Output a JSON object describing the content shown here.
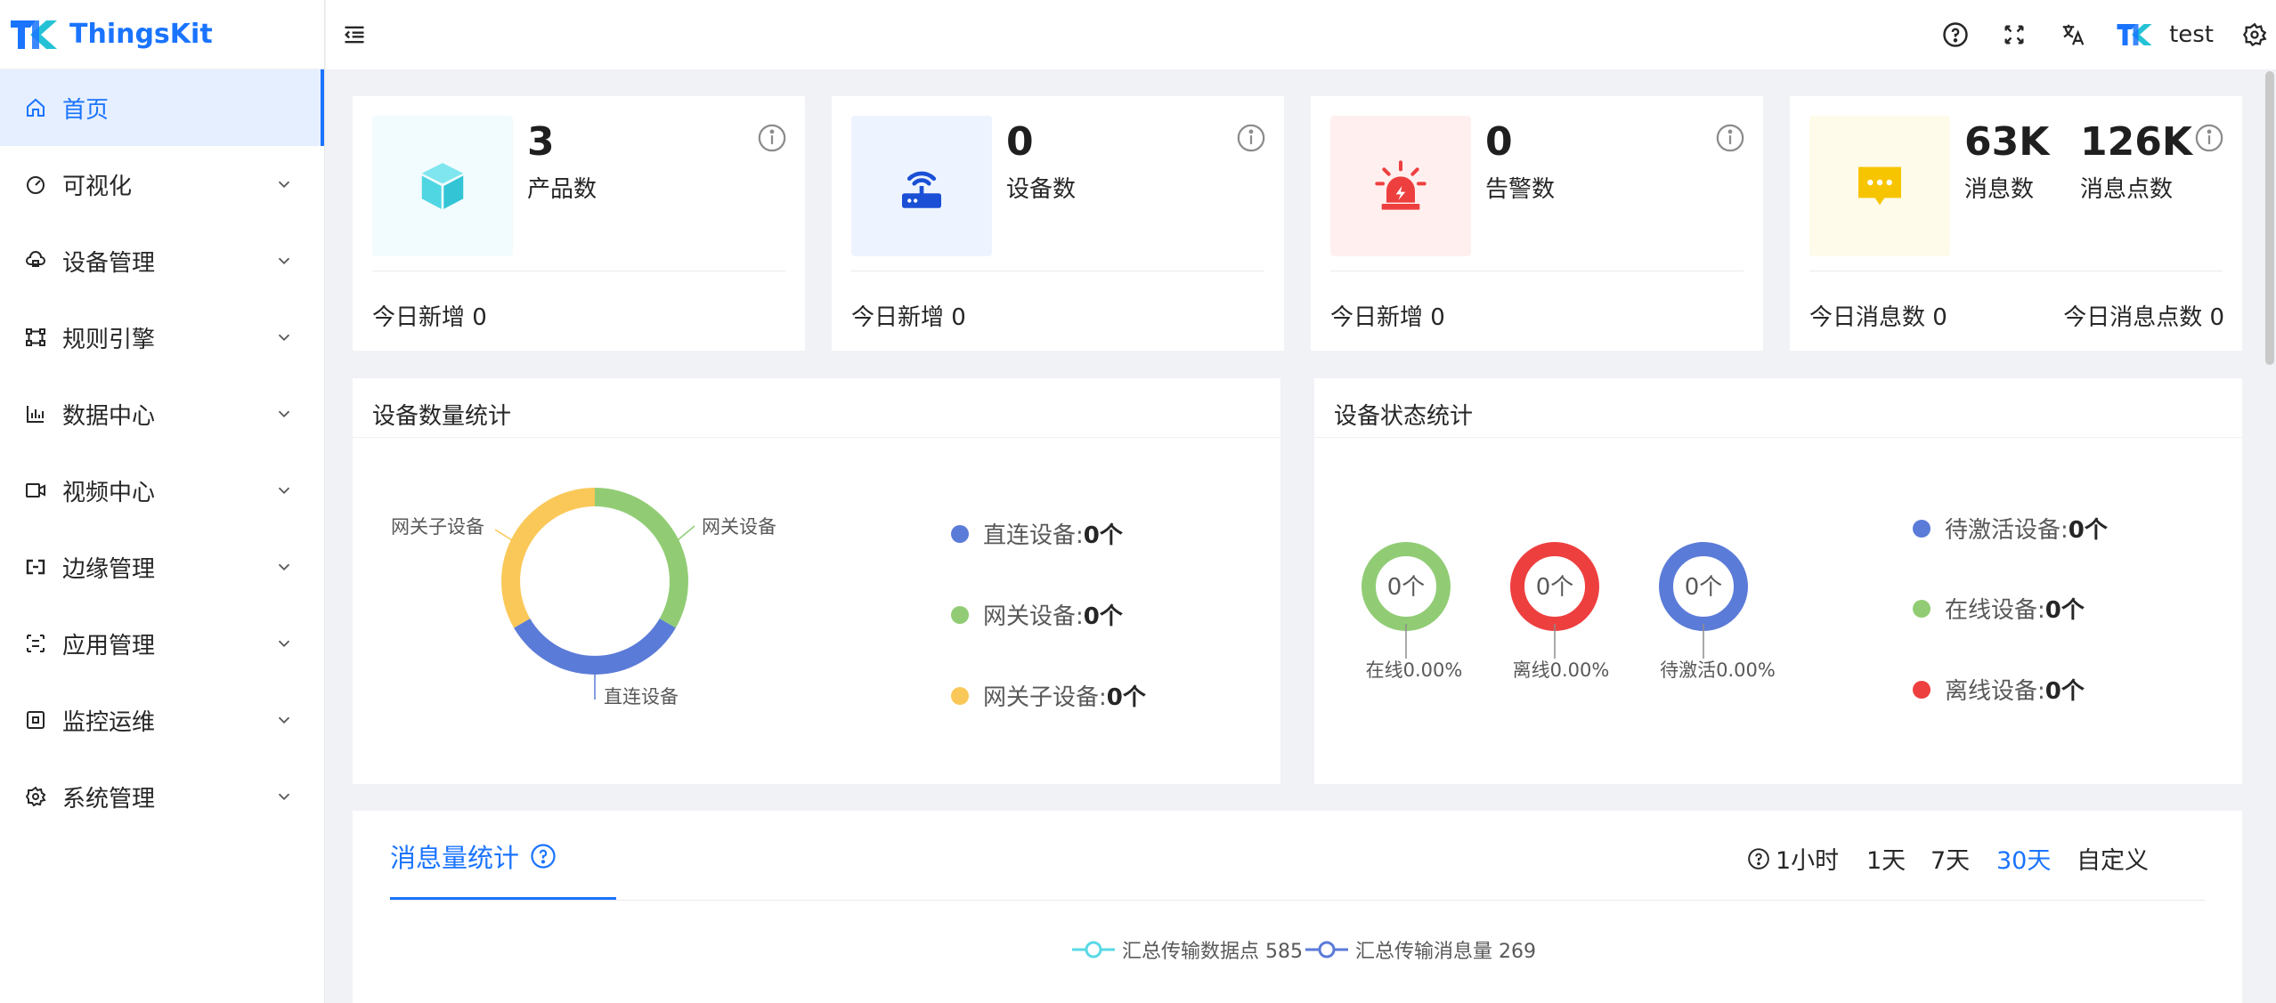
{
  "brand": {
    "name": "ThingsKit"
  },
  "sidebar": {
    "items": [
      {
        "label": "首页",
        "icon": "home-icon",
        "active": true
      },
      {
        "label": "可视化",
        "icon": "dashboard-icon"
      },
      {
        "label": "设备管理",
        "icon": "cloud-device-icon"
      },
      {
        "label": "规则引擎",
        "icon": "rule-engine-icon"
      },
      {
        "label": "数据中心",
        "icon": "bar-chart-icon"
      },
      {
        "label": "视频中心",
        "icon": "video-icon"
      },
      {
        "label": "边缘管理",
        "icon": "edge-icon"
      },
      {
        "label": "应用管理",
        "icon": "app-icon"
      },
      {
        "label": "监控运维",
        "icon": "command-icon"
      },
      {
        "label": "系统管理",
        "icon": "settings-icon"
      }
    ]
  },
  "header": {
    "user_name": "test"
  },
  "stats": {
    "products": {
      "value": "3",
      "label": "产品数",
      "foot": "今日新增 0"
    },
    "devices": {
      "value": "0",
      "label": "设备数",
      "foot": "今日新增 0"
    },
    "alarms": {
      "value": "0",
      "label": "告警数",
      "foot": "今日新增 0"
    },
    "messages": {
      "value1": "63K",
      "label1": "消息数",
      "value2": "126K",
      "label2": "消息点数",
      "foot1": "今日消息数 0",
      "foot2": "今日消息点数 0"
    }
  },
  "device_count": {
    "title": "设备数量统计",
    "chart_labels": {
      "gateway_sub": "网关子设备",
      "gateway": "网关设备",
      "direct": "直连设备"
    },
    "legend": [
      {
        "name": "直连设备:",
        "value": "0个",
        "color": "#5b7bd8"
      },
      {
        "name": "网关设备:",
        "value": "0个",
        "color": "#91cc75"
      },
      {
        "name": "网关子设备:",
        "value": "0个",
        "color": "#fac858"
      }
    ]
  },
  "device_status": {
    "title": "设备状态统计",
    "rings": [
      {
        "value": "0个",
        "caption": "在线0.00%",
        "color": "#91cc75"
      },
      {
        "value": "0个",
        "caption": "离线0.00%",
        "color": "#ee3f3f"
      },
      {
        "value": "0个",
        "caption": "待激活0.00%",
        "color": "#5b7bd8"
      }
    ],
    "legend": [
      {
        "name": "待激活设备:",
        "value": "0个",
        "color": "#5b7bd8"
      },
      {
        "name": "在线设备:",
        "value": "0个",
        "color": "#91cc75"
      },
      {
        "name": "离线设备:",
        "value": "0个",
        "color": "#ee3f3f"
      }
    ]
  },
  "message_stats": {
    "tab": "消息量统计",
    "ranges": [
      "1小时",
      "1天",
      "7天",
      "30天",
      "自定义"
    ],
    "selected_range": "30天",
    "series": [
      {
        "name": "汇总传输数据点 585",
        "color": "#5ad8e6"
      },
      {
        "name": "汇总传输消息量 269",
        "color": "#5b7bd8"
      }
    ]
  },
  "chart_data": [
    {
      "type": "pie",
      "title": "设备数量统计",
      "categories": [
        "直连设备",
        "网关设备",
        "网关子设备"
      ],
      "values": [
        0,
        0,
        0
      ]
    },
    {
      "type": "pie",
      "title": "设备状态统计",
      "categories": [
        "在线",
        "离线",
        "待激活"
      ],
      "values": [
        0,
        0,
        0
      ]
    }
  ]
}
